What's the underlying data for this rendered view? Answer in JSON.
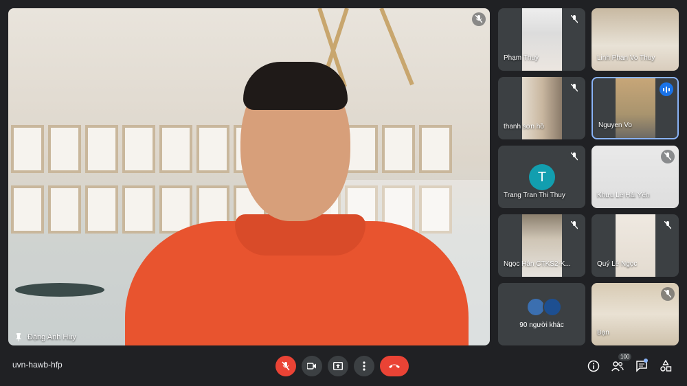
{
  "meeting": {
    "code": "uvn-hawb-hfp"
  },
  "main_tile": {
    "name": "Đặng Anh Huy",
    "muted": true,
    "pinned": true
  },
  "participants": [
    {
      "name": "Phạm Thuỳ",
      "muted": true
    },
    {
      "name": "Linh Phan Vo Thuy",
      "muted": false
    },
    {
      "name": "thanh sơn hồ",
      "muted": true
    },
    {
      "name": "Nguyen Vo",
      "speaking": true
    },
    {
      "name": "Trang Tran Thi Thuy",
      "muted": true,
      "avatar_letter": "T"
    },
    {
      "name": "Khưu Lê Hải Yến",
      "muted": true
    },
    {
      "name": "Ngọc Hân CTKS2-K...",
      "muted": true
    },
    {
      "name": "Quý Lê Ngọc",
      "muted": true
    },
    {
      "name": "Bạn",
      "muted": true
    }
  ],
  "others": {
    "label": "90 người khác"
  },
  "toolbar": {
    "people_count": "100",
    "icons": [
      "mic-off-icon",
      "camera-icon",
      "present-icon",
      "more-vert-icon",
      "end-call-icon",
      "info-icon",
      "people-icon",
      "chat-icon",
      "activities-icon"
    ]
  },
  "colors": {
    "background": "#202124",
    "tile": "#3c4043",
    "danger": "#ea4335",
    "accent": "#1a73e8",
    "avatar_t": "#129eaf"
  }
}
